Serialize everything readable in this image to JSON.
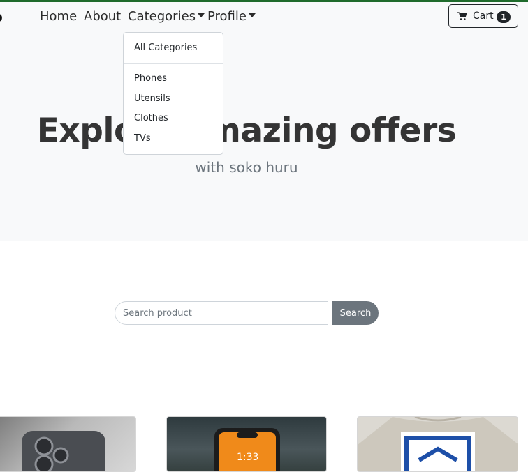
{
  "navbar": {
    "brand": "o",
    "links": [
      {
        "label": "Home"
      },
      {
        "label": "About"
      },
      {
        "label": "Categories"
      },
      {
        "label": "Profile"
      }
    ],
    "cart": {
      "label": "Cart",
      "count": "1"
    }
  },
  "dropdown": {
    "header_item": "All Categories",
    "items": [
      "Phones",
      "Utensils",
      "Clothes",
      "TVs"
    ]
  },
  "hero": {
    "title": "Explore amazing offers",
    "subtitle": "with soko huru"
  },
  "search": {
    "placeholder": "Search product",
    "value": "",
    "button_label": "Search"
  },
  "colors": {
    "top_accent": "#1f6b2c",
    "hero_bg": "#f8f9fa",
    "search_button": "#6c757d"
  },
  "icons": [
    "cart-icon",
    "caret-down-icon"
  ]
}
